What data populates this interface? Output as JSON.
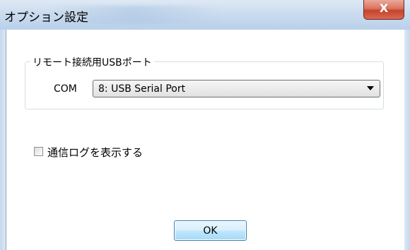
{
  "window": {
    "title": "オプション設定",
    "close_glyph": "X"
  },
  "usb_group": {
    "label": "リモート接続用USBポート",
    "com_label": "COM",
    "com_selected": "8: USB Serial Port"
  },
  "log_option": {
    "label": "通信ログを表示する",
    "checked": false
  },
  "buttons": {
    "ok_label": "OK"
  },
  "colors": {
    "titlebar": "#cbdcef",
    "close_button": "#c7432b",
    "ok_border": "#3c7fb1"
  }
}
